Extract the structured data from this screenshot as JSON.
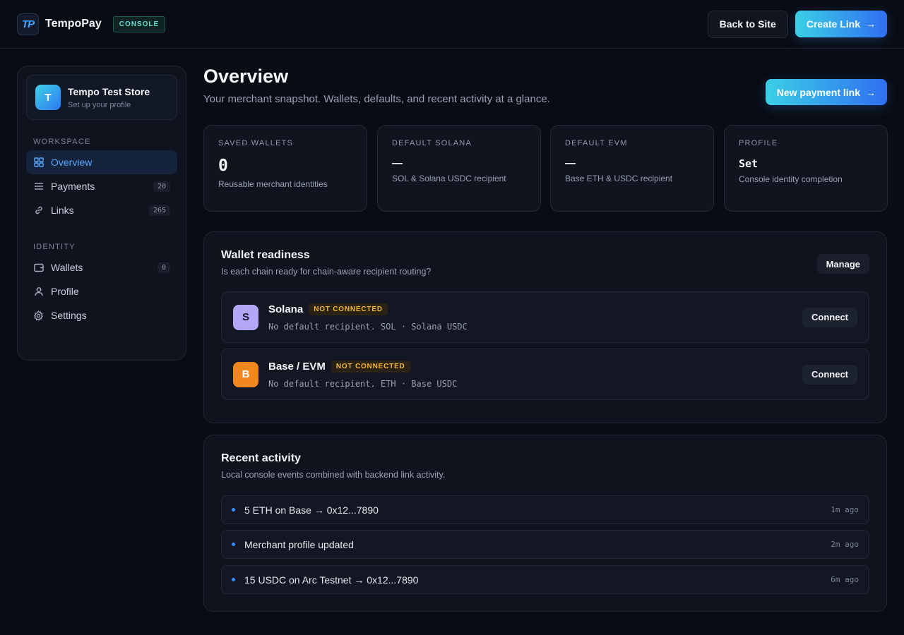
{
  "app": {
    "brand": "TempoPay",
    "logo_text": "TP",
    "badge": "CONSOLE",
    "back_button": "Back to Site",
    "create_button": "Create Link"
  },
  "sidebar": {
    "store": {
      "initial": "T",
      "name": "Tempo Test Store",
      "subtitle": "Set up your profile"
    },
    "sections": [
      {
        "title": "WORKSPACE",
        "items": [
          {
            "label": "Overview",
            "icon": "grid-icon",
            "count": "",
            "active": true
          },
          {
            "label": "Payments",
            "icon": "list-icon",
            "count": "20",
            "active": false
          },
          {
            "label": "Links",
            "icon": "link-icon",
            "count": "265",
            "active": false
          }
        ]
      },
      {
        "title": "IDENTITY",
        "items": [
          {
            "label": "Wallets",
            "icon": "wallet-icon",
            "count": "0",
            "active": false
          },
          {
            "label": "Profile",
            "icon": "user-icon",
            "count": "",
            "active": false
          },
          {
            "label": "Settings",
            "icon": "gear-icon",
            "count": "",
            "active": false
          }
        ]
      }
    ]
  },
  "main": {
    "title": "Overview",
    "subtitle": "Your merchant snapshot. Wallets, defaults, and recent activity at a glance.",
    "new_link_button": "New payment link",
    "stats": [
      {
        "label": "SAVED WALLETS",
        "value": "0",
        "desc": "Reusable merchant identities"
      },
      {
        "label": "DEFAULT SOLANA",
        "value": "—",
        "desc": "SOL & Solana USDC recipient"
      },
      {
        "label": "DEFAULT EVM",
        "value": "—",
        "desc": "Base ETH & USDC recipient"
      },
      {
        "label": "PROFILE",
        "value": "Set",
        "desc": "Console identity completion"
      }
    ],
    "wallet_readiness": {
      "title": "Wallet readiness",
      "subtitle": "Is each chain ready for chain-aware recipient routing?",
      "manage_button": "Manage",
      "chains": [
        {
          "initial": "S",
          "name": "Solana",
          "status": "NOT CONNECTED",
          "desc": "No default recipient. SOL · Solana USDC",
          "action": "Connect",
          "icon_bg": "#b3a6f5",
          "icon_fg": "#1b1530"
        },
        {
          "initial": "B",
          "name": "Base / EVM",
          "status": "NOT CONNECTED",
          "desc": "No default recipient. ETH · Base USDC",
          "action": "Connect",
          "icon_bg": "#f2861f",
          "icon_fg": "#ffffff"
        }
      ]
    },
    "recent_activity": {
      "title": "Recent activity",
      "subtitle": "Local console events combined with backend link activity.",
      "items": [
        {
          "text": "5 ETH on Base → 0x12...7890",
          "time": "1m ago"
        },
        {
          "text": "Merchant profile updated",
          "time": "2m ago"
        },
        {
          "text": "15 USDC on Arc Testnet → 0x12...7890",
          "time": "6m ago"
        }
      ]
    }
  },
  "colors": {
    "accent": "#3b8cff",
    "warning": "#f0b63a",
    "background": "#090c14"
  }
}
